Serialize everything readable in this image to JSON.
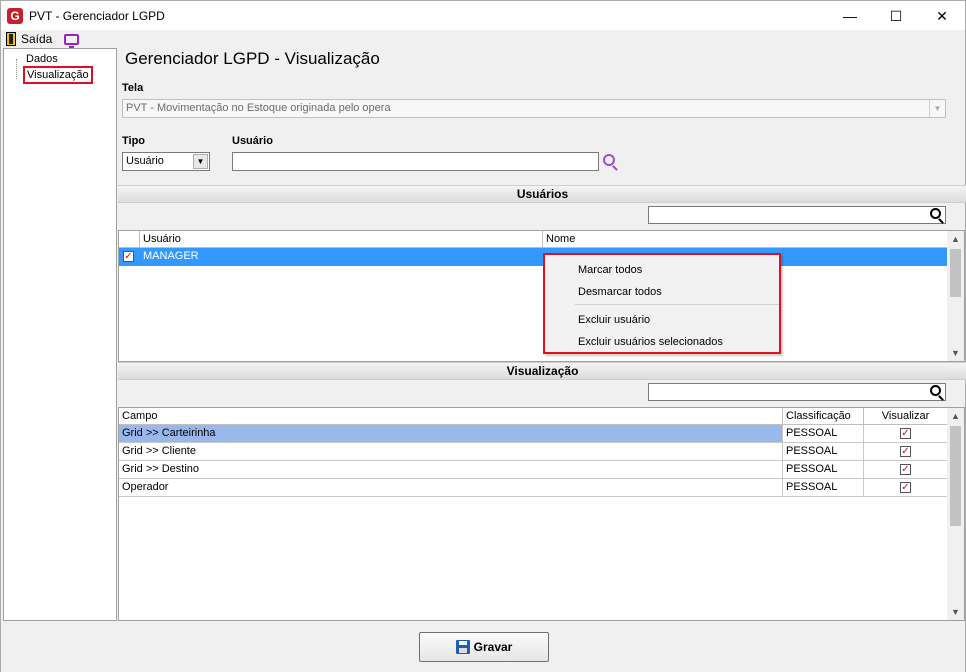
{
  "window": {
    "title": "PVT - Gerenciador LGPD",
    "minimize": "—",
    "maximize": "☐",
    "close": "✕"
  },
  "toolbar": {
    "exit_label": "Saída"
  },
  "tree": {
    "items": [
      {
        "label": "Dados"
      },
      {
        "label": "Visualização"
      }
    ]
  },
  "main": {
    "title": "Gerenciador LGPD - Visualização"
  },
  "tela": {
    "label": "Tela",
    "value": "PVT - Movimentação no Estoque originada pelo opera"
  },
  "tipo": {
    "label": "Tipo",
    "value": "Usuário"
  },
  "usuario_field": {
    "label": "Usuário",
    "value": ""
  },
  "usuarios_section": {
    "header": "Usuários",
    "columns": [
      "Usuário",
      "Nome"
    ],
    "rows": [
      {
        "usuario": "MANAGER",
        "nome": "",
        "checked": true
      }
    ]
  },
  "context_menu": {
    "items": [
      "Marcar todos",
      "Desmarcar todos",
      "Excluir usuário",
      "Excluir usuários selecionados"
    ]
  },
  "visualizacao_section": {
    "header": "Visualização",
    "columns": [
      "Campo",
      "Classificação",
      "Visualizar"
    ],
    "rows": [
      {
        "campo": "Grid >> Carteirinha",
        "classificacao": "PESSOAL",
        "visualizar": true
      },
      {
        "campo": "Grid >> Cliente",
        "classificacao": "PESSOAL",
        "visualizar": true
      },
      {
        "campo": "Grid >> Destino",
        "classificacao": "PESSOAL",
        "visualizar": true
      },
      {
        "campo": "Operador",
        "classificacao": "PESSOAL",
        "visualizar": true
      }
    ]
  },
  "actions": {
    "save_label": "Gravar"
  },
  "colors": {
    "selection": "#3399ff",
    "selection_row2": "#98b8ec",
    "highlight_border": "#e01020"
  }
}
